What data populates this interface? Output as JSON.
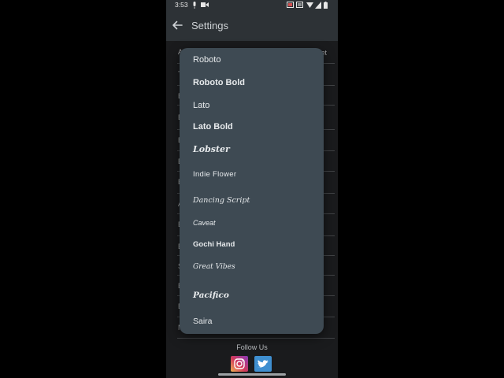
{
  "status_bar": {
    "time": "3:53",
    "icons": [
      "mic-icon",
      "video-icon",
      "notification-icon",
      "vibrate-icon",
      "wifi-icon",
      "signal-icon",
      "battery-icon"
    ]
  },
  "app_bar": {
    "title": "Settings",
    "back_icon": "arrow-back-icon"
  },
  "settings_list": {
    "rows": [
      {
        "label": "A",
        "trailing": "et"
      },
      {
        "label": "T"
      },
      {
        "label": "B"
      },
      {
        "label": "B"
      },
      {
        "label": "B"
      },
      {
        "label": "B"
      },
      {
        "label": "B"
      },
      {
        "label": "A"
      },
      {
        "label": "B"
      },
      {
        "label": "B"
      },
      {
        "label": "S"
      },
      {
        "label": "B"
      },
      {
        "label": "B"
      },
      {
        "label": "N"
      }
    ]
  },
  "font_menu": {
    "options": [
      {
        "label": "Roboto"
      },
      {
        "label": "Roboto Bold"
      },
      {
        "label": "Lato"
      },
      {
        "label": "Lato Bold"
      },
      {
        "label": "Lobster"
      },
      {
        "label": "Indie Flower"
      },
      {
        "label": "Dancing Script"
      },
      {
        "label": "Caveat"
      },
      {
        "label": "Gochi Hand"
      },
      {
        "label": "Great Vibes"
      },
      {
        "label": "Pacifico"
      },
      {
        "label": "Saira"
      }
    ]
  },
  "footer": {
    "follow_label": "Follow Us",
    "social": [
      "instagram-icon",
      "twitter-icon"
    ]
  },
  "colors": {
    "app_bar": "#2d3236",
    "background": "#1e1f21",
    "menu": "#3e4a53",
    "menu_text": "#e7eaec",
    "twitter": "#3f8fd0"
  }
}
